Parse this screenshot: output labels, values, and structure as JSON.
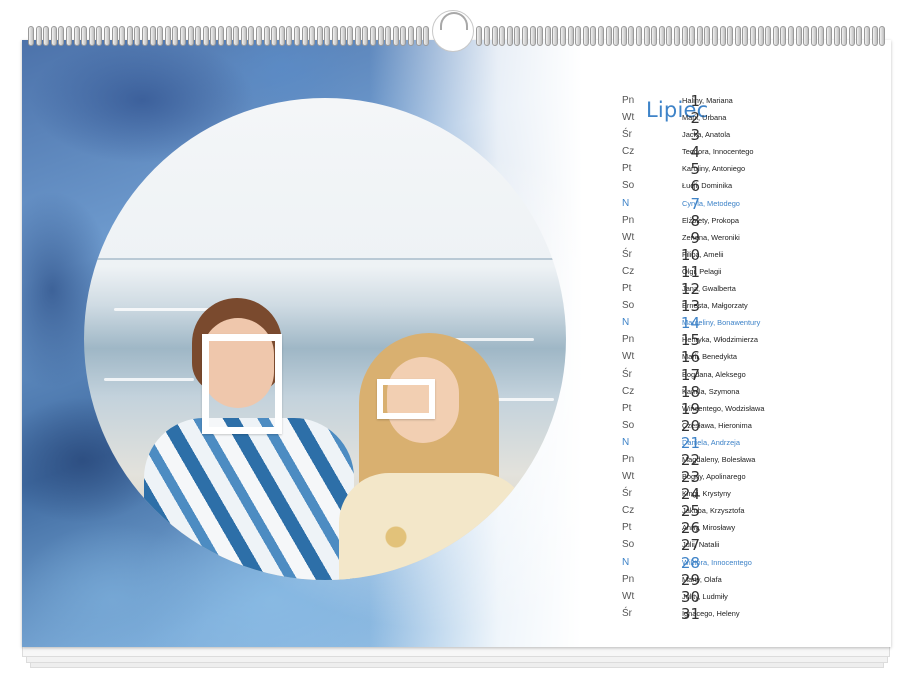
{
  "calendar": {
    "month": "Lipiec",
    "accent_color": "#3e83c8",
    "days": [
      {
        "wd": "Pn",
        "n": "1",
        "names": "Haliny, Mariana"
      },
      {
        "wd": "Wt",
        "n": "2",
        "names": "Marii, Urbana"
      },
      {
        "wd": "Śr",
        "n": "3",
        "names": "Jacka, Anatola"
      },
      {
        "wd": "Cz",
        "n": "4",
        "names": "Teodora, Innocentego"
      },
      {
        "wd": "Pt",
        "n": "5",
        "names": "Karoliny, Antoniego"
      },
      {
        "wd": "So",
        "n": "6",
        "names": "Łucji, Dominika"
      },
      {
        "wd": "N",
        "n": "7",
        "names": "Cyryla, Metodego",
        "sunday": true
      },
      {
        "wd": "Pn",
        "n": "8",
        "names": "Elżbiety, Prokopa"
      },
      {
        "wd": "Wt",
        "n": "9",
        "names": "Zenona, Weroniki"
      },
      {
        "wd": "Śr",
        "n": "10",
        "names": "Filipa, Amelii"
      },
      {
        "wd": "Cz",
        "n": "11",
        "names": "Olgi, Pelagii"
      },
      {
        "wd": "Pt",
        "n": "12",
        "names": "Jana, Gwalberta"
      },
      {
        "wd": "So",
        "n": "13",
        "names": "Ernesta, Małgorzaty"
      },
      {
        "wd": "N",
        "n": "14",
        "names": "Marceliny, Bonawentury",
        "sunday": true
      },
      {
        "wd": "Pn",
        "n": "15",
        "names": "Henryka, Włodzimierza"
      },
      {
        "wd": "Wt",
        "n": "16",
        "names": "Marii, Benedykta"
      },
      {
        "wd": "Śr",
        "n": "17",
        "names": "Bogdana, Aleksego"
      },
      {
        "wd": "Cz",
        "n": "18",
        "names": "Kamila, Szymona"
      },
      {
        "wd": "Pt",
        "n": "19",
        "names": "Wincentego, Wodzisława"
      },
      {
        "wd": "So",
        "n": "20",
        "names": "Czesława, Hieronima"
      },
      {
        "wd": "N",
        "n": "21",
        "names": "Daniela, Andrzeja",
        "sunday": true
      },
      {
        "wd": "Pn",
        "n": "22",
        "names": "Magdaleny, Bolesława"
      },
      {
        "wd": "Wt",
        "n": "23",
        "names": "Bogny, Apolinarego"
      },
      {
        "wd": "Śr",
        "n": "24",
        "names": "Kingi, Krystyny"
      },
      {
        "wd": "Cz",
        "n": "25",
        "names": "Jakuba, Krzysztofa"
      },
      {
        "wd": "Pt",
        "n": "26",
        "names": "Anny, Mirosławy"
      },
      {
        "wd": "So",
        "n": "27",
        "names": "Julii, Natalii"
      },
      {
        "wd": "N",
        "n": "28",
        "names": "Wiktora, Innocentego",
        "sunday": true
      },
      {
        "wd": "Pn",
        "n": "29",
        "names": "Marty, Olafa"
      },
      {
        "wd": "Wt",
        "n": "30",
        "names": "Julity, Ludmiły"
      },
      {
        "wd": "Śr",
        "n": "31",
        "names": "Ignacego, Heleny"
      }
    ]
  }
}
